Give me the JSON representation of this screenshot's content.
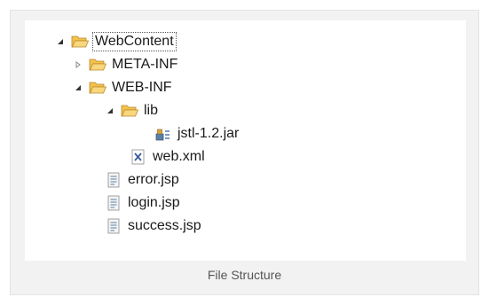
{
  "tree": {
    "items": [
      {
        "label": "WebContent",
        "icon": "folder-open-icon",
        "toggle": "expanded"
      },
      {
        "label": "META-INF",
        "icon": "folder-icon",
        "toggle": "collapsed"
      },
      {
        "label": "WEB-INF",
        "icon": "folder-open-icon",
        "toggle": "expanded"
      },
      {
        "label": "lib",
        "icon": "folder-open-icon",
        "toggle": "expanded"
      },
      {
        "label": "jstl-1.2.jar",
        "icon": "jar-file-icon",
        "toggle": "none"
      },
      {
        "label": "web.xml",
        "icon": "xml-file-icon",
        "toggle": "none"
      },
      {
        "label": "error.jsp",
        "icon": "jsp-file-icon",
        "toggle": "none"
      },
      {
        "label": "login.jsp",
        "icon": "jsp-file-icon",
        "toggle": "none"
      },
      {
        "label": "success.jsp",
        "icon": "jsp-file-icon",
        "toggle": "none"
      }
    ]
  },
  "caption": "File Structure",
  "colors": {
    "folder": "#f2c14e",
    "folder_outline": "#b8892a",
    "background": "#f2f2f2",
    "panel": "#ffffff"
  }
}
